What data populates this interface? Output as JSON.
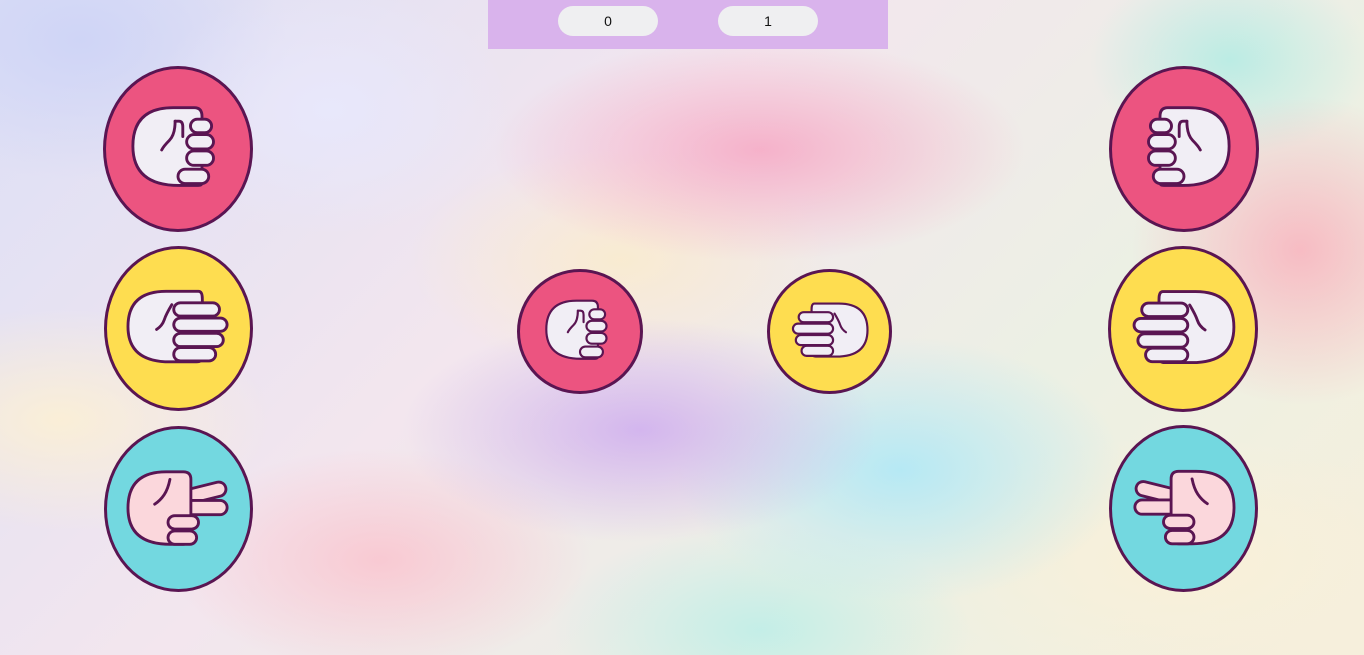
{
  "scoreboard": {
    "player_score": "0",
    "computer_score": "1"
  },
  "player_choices": [
    {
      "id": "rock",
      "icon": "fist-icon"
    },
    {
      "id": "paper",
      "icon": "open-hand-icon"
    },
    {
      "id": "scissors",
      "icon": "two-fingers-icon"
    }
  ],
  "computer_choices": [
    {
      "id": "rock",
      "icon": "fist-icon"
    },
    {
      "id": "paper",
      "icon": "open-hand-icon"
    },
    {
      "id": "scissors",
      "icon": "two-fingers-icon"
    }
  ],
  "arena": {
    "player_pick": "rock",
    "computer_pick": "paper"
  },
  "colors": {
    "rock": "#ec5480",
    "paper": "#fedd50",
    "scissors": "#73d8e0",
    "outline": "#5a1552",
    "scoreboard_bg": "#d9b3ec",
    "hand_fill": "#f1eef5",
    "scissors_hand_fill": "#fbd7dc"
  }
}
